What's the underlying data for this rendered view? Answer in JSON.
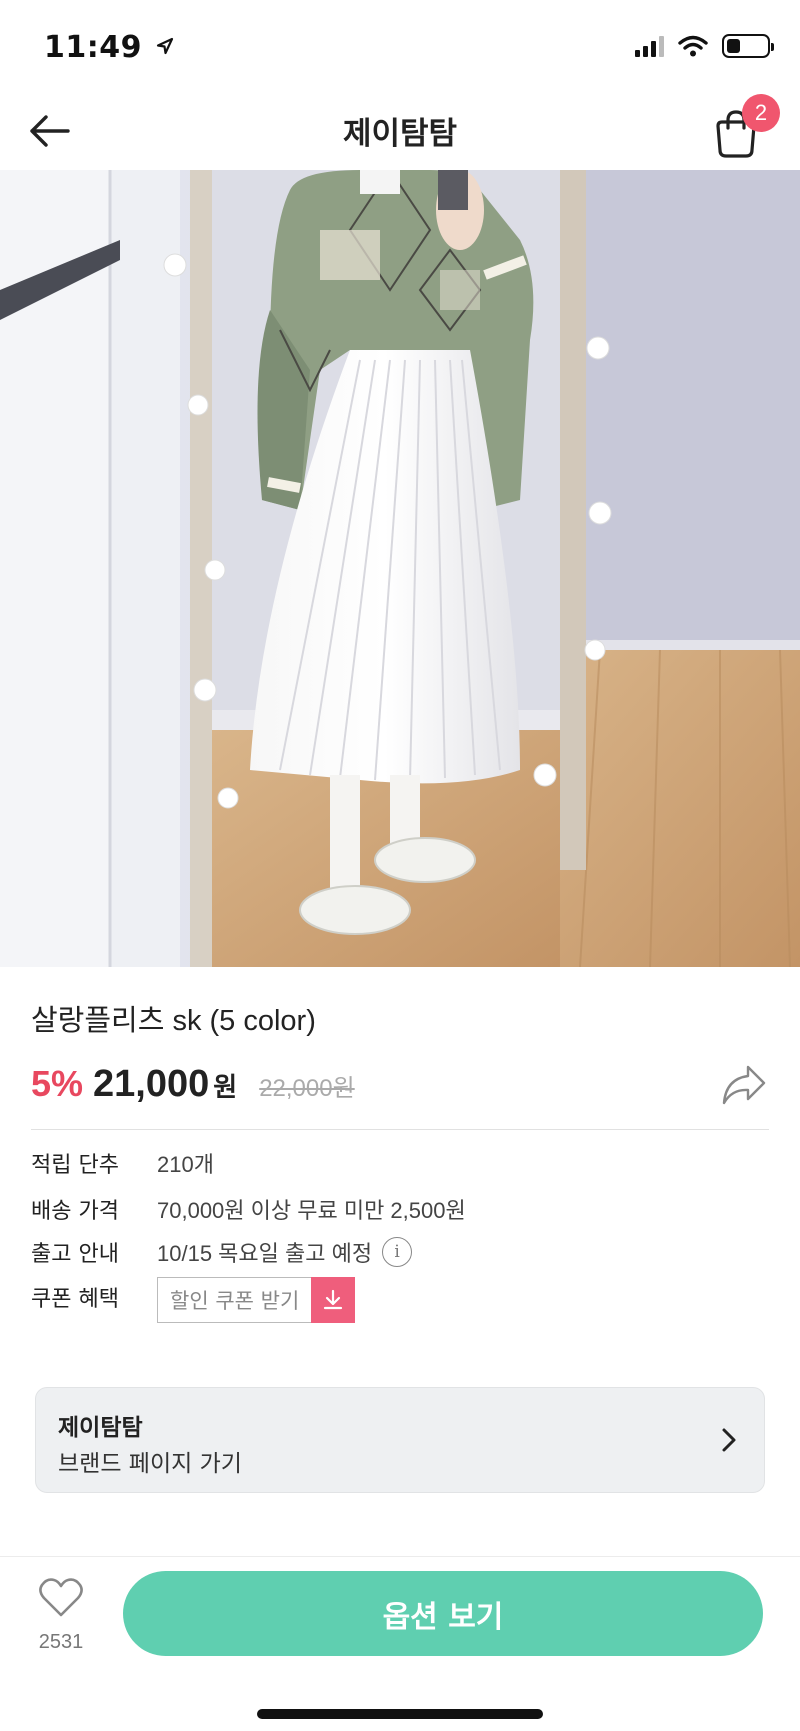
{
  "status_bar": {
    "time": "11:49",
    "icons": [
      "location-arrow-icon",
      "cellular-signal-icon",
      "wifi-icon",
      "battery-icon"
    ],
    "battery_level": 0.34
  },
  "nav": {
    "back_icon": "back-arrow-icon",
    "title": "제이탐탐",
    "cart_icon": "shopping-bag-icon",
    "cart_count": "2"
  },
  "product": {
    "image_alt": "pleated white skirt outfit mirror selfie",
    "name": "살랑플리츠 sk (5 color)",
    "discount": "5%",
    "price": "21,000",
    "price_unit": "원",
    "original_price": "22,000원",
    "share_icon": "share-icon"
  },
  "info": {
    "rows": [
      {
        "label": "적립 단추",
        "value": "210개"
      },
      {
        "label": "배송 가격",
        "value": "70,000원 이상 무료 미만 2,500원"
      },
      {
        "label": "출고 안내",
        "value": "10/15 목요일 출고 예정",
        "icon": "info-icon"
      }
    ],
    "coupon": {
      "label": "쿠폰 혜택",
      "button": "할인 쿠폰 받기",
      "icon": "download-icon"
    }
  },
  "brand": {
    "name": "제이탐탐",
    "link": "브랜드 페이지 가기",
    "icon": "chevron-right-icon"
  },
  "bottom": {
    "like_icon": "heart-icon",
    "like_count": "2531",
    "option_button": "옵션 보기"
  },
  "colors": {
    "accent_pink": "#e8485f",
    "badge_pink": "#f0566e",
    "coupon_pink": "#ef5e7c",
    "cta_mint": "#5fcfb0"
  }
}
